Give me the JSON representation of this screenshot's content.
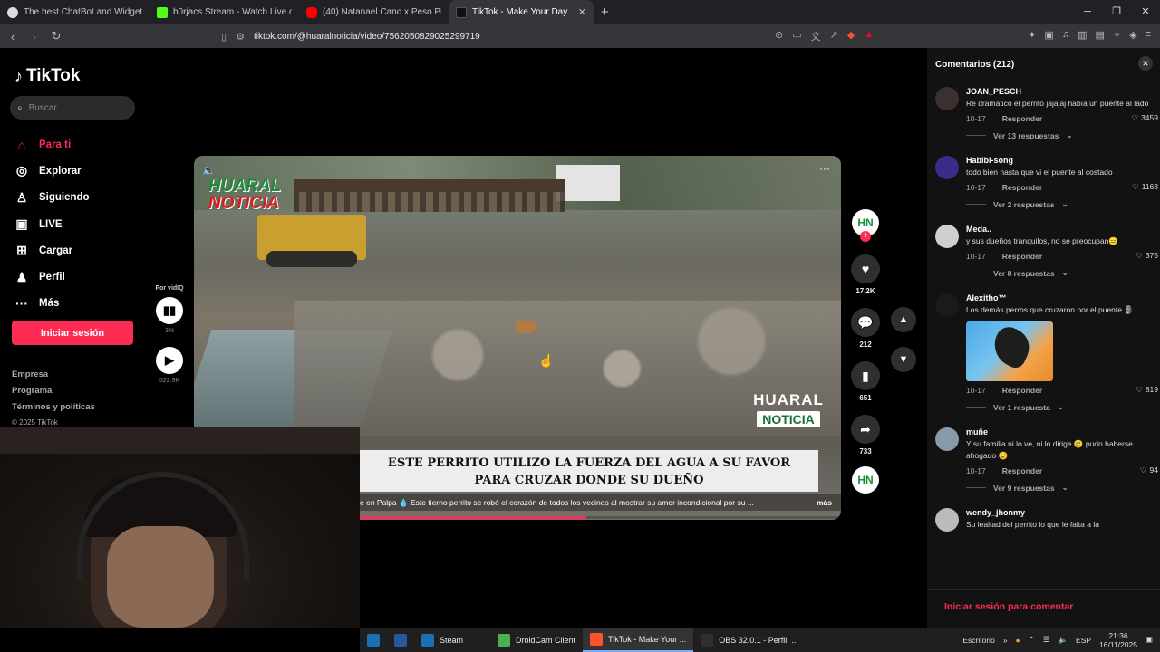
{
  "browser": {
    "tabs": [
      {
        "title": "The best ChatBot and Widgets for Ki",
        "color": "#ffffff"
      },
      {
        "title": "b0rjacs Stream - Watch Live on Kick",
        "color": "#53fc18"
      },
      {
        "title": "(40) Natanael Cano x Peso Pluma x C",
        "color": "#ff0000"
      },
      {
        "title": "TikTok - Make Your Day",
        "color": "#000000"
      }
    ],
    "url": "tiktok.com/@huaralnoticia/video/7562050829025299719"
  },
  "sidebar": {
    "logo": "TikTok",
    "search_placeholder": "Buscar",
    "menu": [
      {
        "label": "Para ti",
        "icon": "home-icon",
        "active": true
      },
      {
        "label": "Explorar",
        "icon": "compass-icon"
      },
      {
        "label": "Siguiendo",
        "icon": "user-icon"
      },
      {
        "label": "LIVE",
        "icon": "live-icon"
      },
      {
        "label": "Cargar",
        "icon": "upload-icon"
      },
      {
        "label": "Perfil",
        "icon": "profile-icon"
      },
      {
        "label": "Más",
        "icon": "more-icon"
      }
    ],
    "login": "Iniciar sesión",
    "footer": [
      "Empresa",
      "Programa",
      "Términos y políticas"
    ],
    "copyright": "© 2025 TikTok"
  },
  "vidiq": {
    "label": "Por vidIQ",
    "percent": "3%",
    "views": "522.9K"
  },
  "video": {
    "brand_top_1": "HUARAL",
    "brand_top_2": "NOTICIA",
    "brand_br_1": "HUARAL",
    "brand_br_2": "NOTICIA",
    "caption_line1": "ESTE PERRITO UTILIZO LA FUERZA DEL AGUA A SU FAVOR",
    "caption_line2": "PARA CRUZAR DONDE SU DUEÑO",
    "description": "e en Palpa 💧 Este tierno perrito se robó el corazón de todos los vecinos al mostrar su amor incondicional por su ...",
    "more": "más",
    "progress": 0.47
  },
  "actions": {
    "avatar": "HN",
    "likes": "17.2K",
    "comments": "212",
    "saves": "651",
    "shares": "733"
  },
  "comments": {
    "title": "Comentarios (212)",
    "items": [
      {
        "user": "JOAN_PESCH",
        "text": "Re dramático el perrito jajajaj había un puente al lado",
        "date": "10-17",
        "reply": "Responder",
        "likes": "3459",
        "replies": "Ver 13 respuestas",
        "avatar_color": "#3a3030"
      },
      {
        "user": "Habibi-song",
        "text": "todo bien hasta que vi el puente al costado",
        "date": "10-17",
        "reply": "Responder",
        "likes": "1163",
        "replies": "Ver 2 respuestas",
        "avatar_color": "#3a2a8a"
      },
      {
        "user": "Meda..",
        "text": "y sus dueños tranquilos, no se preocupan😑",
        "date": "10-17",
        "reply": "Responder",
        "likes": "375",
        "replies": "Ver 8 respuestas",
        "avatar_color": "#cfcfcf"
      },
      {
        "user": "Alexitho™",
        "text": "Los demás perros que cruzaron por el puente 🗿",
        "date": "10-17",
        "reply": "Responder",
        "likes": "819",
        "replies": "Ver 1 respuesta",
        "avatar_color": "#1a1a1a",
        "sticker": true
      },
      {
        "user": "muñe",
        "text": "Y su familia ni lo ve, ni lo dirige 🥲 pudo haberse ahogado 😢",
        "date": "10-17",
        "reply": "Responder",
        "likes": "94",
        "replies": "Ver 9 respuestas",
        "avatar_color": "#8899aa"
      },
      {
        "user": "wendy_jhonmy",
        "text": "Su lealtad del perrito lo que le falta a la",
        "date": "",
        "reply": "",
        "likes": "",
        "replies": "",
        "avatar_color": "#bbbbbb"
      }
    ],
    "login_to_comment": "Iniciar sesión para comentar"
  },
  "taskbar": {
    "apps": [
      {
        "label": "",
        "icon": "steam-icon-small",
        "color": "#1b6fb3"
      },
      {
        "label": "",
        "icon": "word-icon",
        "color": "#2b579a"
      },
      {
        "label": "Steam",
        "icon": "steam-icon",
        "color": "#1b6fb3"
      },
      {
        "label": "DroidCam Client",
        "icon": "droidcam-icon",
        "color": "#4caf50"
      },
      {
        "label": "TikTok - Make Your ...",
        "icon": "brave-icon",
        "color": "#fb542b"
      },
      {
        "label": "OBS 32.0.1 - Perfil: ...",
        "icon": "obs-icon",
        "color": "#302e31"
      }
    ],
    "desktop": "Escritorio",
    "lang": "ESP",
    "time": "21:36",
    "date": "16/11/2025"
  }
}
